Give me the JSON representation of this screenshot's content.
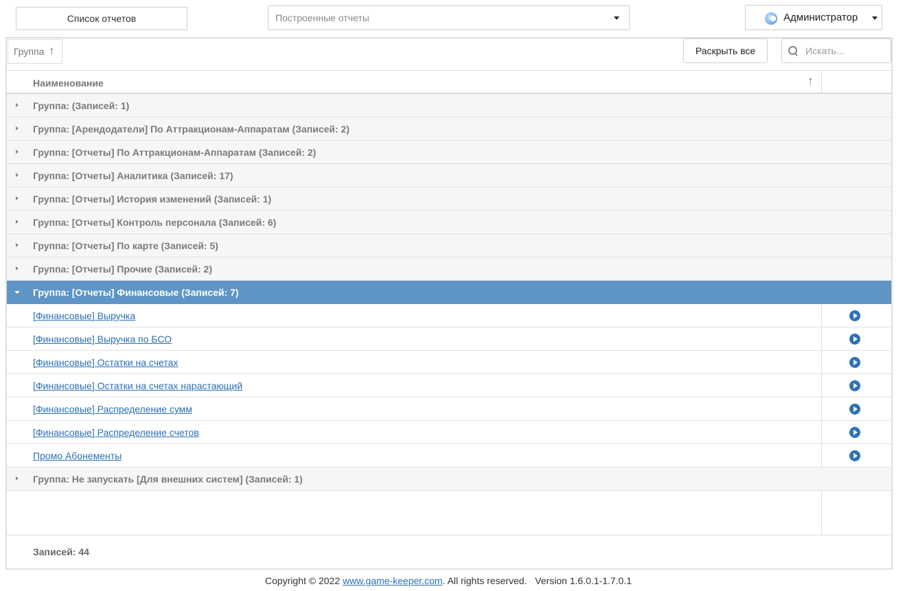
{
  "topbar": {
    "reports_button": "Список отчетов",
    "reports_select": "Построенные отчеты",
    "user_name": "Администратор"
  },
  "toolbar": {
    "group_chip": "Группа",
    "group_chip_arrow": "↑",
    "expand_all": "Раскрыть все",
    "search_placeholder": "Искать..."
  },
  "grid": {
    "column_title": "Наименование",
    "sort_arrow": "↑",
    "groups_before": [
      "Группа: (Записей: 1)",
      "Группа: [Арендодатели] По Аттракционам-Аппаратам (Записей: 2)",
      "Группа: [Отчеты] По Аттракционам-Аппаратам (Записей: 2)",
      "Группа: [Отчеты] Аналитика (Записей: 17)",
      "Группа: [Отчеты] История изменений (Записей: 1)",
      "Группа: [Отчеты] Контроль персонала (Записей: 6)",
      "Группа: [Отчеты] По карте (Записей: 5)",
      "Группа: [Отчеты] Прочие (Записей: 2)"
    ],
    "active_group": "Группа: [Отчеты] Финансовые (Записей: 7)",
    "active_group_items": [
      "[Финансовые] Выручка",
      "[Финансовые] Выручка по БСО",
      "[Финансовые] Остатки на счетах",
      "[Финансовые] Остатки на счетах нарастающий",
      "[Финансовые] Распределение сумм",
      "[Финансовые] Распределение счетов",
      "Промо Абонементы"
    ],
    "groups_after": [
      "Группа: Не запускать [Для внешних систем] (Записей: 1)"
    ],
    "footer_count": "Записей: 44"
  },
  "footer": {
    "copyright_prefix": "Copyright © 2022 ",
    "site_link": "www.game-keeper.com",
    "copyright_suffix": ". All rights reserved.",
    "version": "Version 1.6.0.1-1.7.0.1"
  },
  "colors": {
    "active_row": "#5e95c6",
    "link": "#2a6fb5",
    "play_icon": "#2f72b8",
    "group_row_bg": "#f6f6f6"
  }
}
